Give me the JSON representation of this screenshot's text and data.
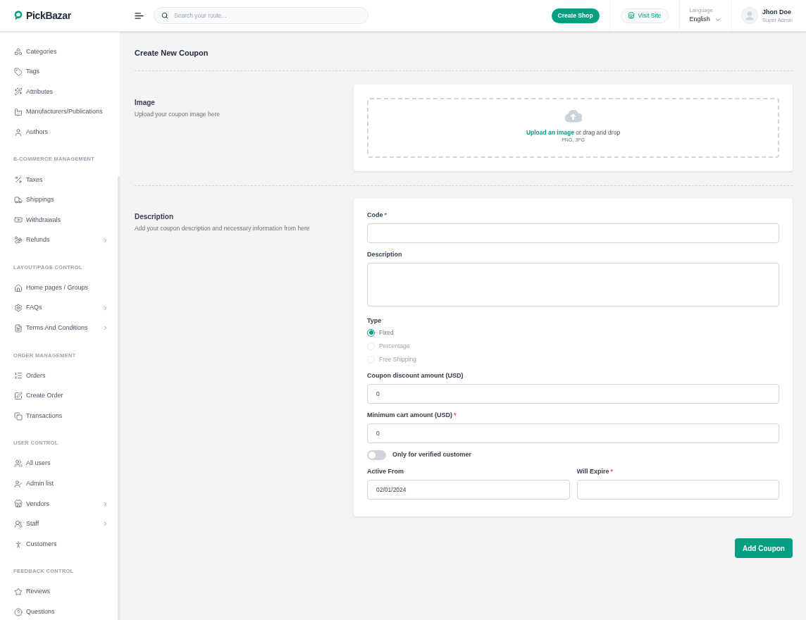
{
  "brand": {
    "name": "PickBazar"
  },
  "header": {
    "search": {
      "placeholder": "Search your route..."
    },
    "create_shop": "Create Shop",
    "visit_site": "Visit Site",
    "language": {
      "label": "Language",
      "value": "English"
    },
    "user": {
      "name": "Jhon Doe",
      "role": "Super Admin"
    }
  },
  "sidebar": {
    "sections": [
      {
        "items": [
          {
            "label": "Categories",
            "expandable": false
          },
          {
            "label": "Tags",
            "expandable": false
          },
          {
            "label": "Attributes",
            "expandable": false
          },
          {
            "label": "Manufacturers/Publications",
            "expandable": false
          },
          {
            "label": "Authors",
            "expandable": false
          }
        ]
      },
      {
        "title": "E-COMMERCE MANAGEMENT",
        "items": [
          {
            "label": "Taxes",
            "expandable": false
          },
          {
            "label": "Shippings",
            "expandable": false
          },
          {
            "label": "Withdrawals",
            "expandable": false
          },
          {
            "label": "Refunds",
            "expandable": true
          }
        ]
      },
      {
        "title": "LAYOUT/PAGE CONTROL",
        "items": [
          {
            "label": "Home pages / Groups",
            "expandable": false
          },
          {
            "label": "FAQs",
            "expandable": true
          },
          {
            "label": "Terms And Conditions",
            "expandable": true
          }
        ]
      },
      {
        "title": "ORDER MANAGEMENT",
        "items": [
          {
            "label": "Orders",
            "expandable": false
          },
          {
            "label": "Create Order",
            "expandable": false
          },
          {
            "label": "Transactions",
            "expandable": false
          }
        ]
      },
      {
        "title": "USER CONTROL",
        "items": [
          {
            "label": "All users",
            "expandable": false
          },
          {
            "label": "Admin list",
            "expandable": false
          },
          {
            "label": "Vendors",
            "expandable": true
          },
          {
            "label": "Staff",
            "expandable": true
          },
          {
            "label": "Customers",
            "expandable": false
          }
        ]
      },
      {
        "title": "FEEDBACK CONTROL",
        "items": [
          {
            "label": "Reviews",
            "expandable": false
          },
          {
            "label": "Questions",
            "expandable": false
          }
        ]
      }
    ]
  },
  "page": {
    "title": "Create New Coupon"
  },
  "image_section": {
    "title": "Image",
    "subtitle": "Upload your coupon image here",
    "upload": {
      "link": "Upload an image",
      "text": "or drag and drop",
      "formats": "PNG, JPG"
    }
  },
  "description_section": {
    "title": "Description",
    "subtitle": "Add your coupon description and necessary information from here",
    "fields": [
      {
        "kind": "input",
        "label": "Code",
        "required_mark": "*"
      },
      {
        "kind": "textarea",
        "label": "Description"
      },
      {
        "kind": "radio",
        "label": "Type",
        "options": [
          {
            "label": "Fixed",
            "selected": true
          },
          {
            "label": "Percentage",
            "selected": false
          },
          {
            "label": "Free Shipping",
            "selected": false
          }
        ]
      },
      {
        "kind": "input",
        "label": "Coupon discount amount (USD)",
        "value": "0"
      },
      {
        "kind": "input",
        "label": "Minimum cart amount (USD)",
        "required_mark": "*",
        "value": "0"
      },
      {
        "kind": "toggle",
        "label": "Only for verified customer",
        "on": false
      },
      {
        "kind": "dates",
        "items": [
          {
            "label": "Active From",
            "value": "02/01/2024"
          },
          {
            "label": "Will Expire",
            "required_mark": "*"
          }
        ]
      }
    ]
  },
  "submit": {
    "label": "Add Coupon"
  }
}
